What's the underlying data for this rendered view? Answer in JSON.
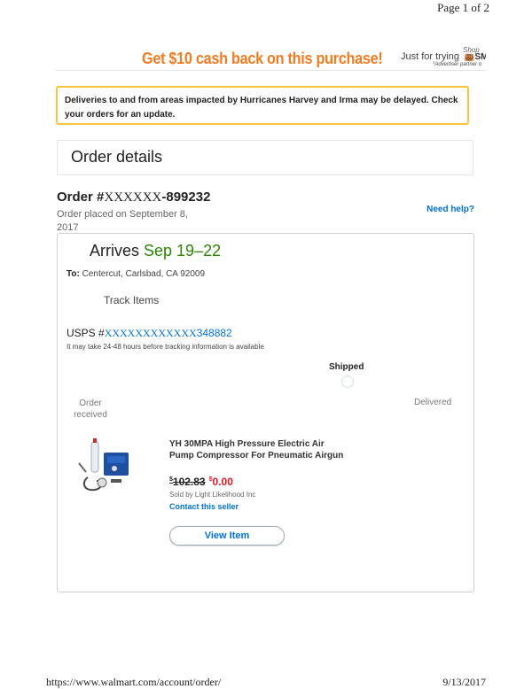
{
  "page": {
    "page_label": "Page 1 of 2"
  },
  "promo": {
    "text_pre": "Get ",
    "amount": "$10",
    "text_post": " cash back on this purchase!",
    "partner_text": "Just for trying",
    "partner_brand_small": "Shop",
    "partner_brand": "SMA",
    "partner_note": "*Advertiser partner o"
  },
  "alert": {
    "message": "Deliveries to and from areas impacted by Hurricanes Harvey and Irma may be delayed. Check your orders for an update."
  },
  "order_details_title": "Order details",
  "order": {
    "number_prefix": "Order #",
    "number_masked": "XXXXXX",
    "number_suffix": "-899232",
    "placed": "Order placed on September 8, 2017",
    "need_help": "Need help?"
  },
  "shipment": {
    "arrives_label": "Arrives ",
    "arrives_date": "Sep 19–22",
    "to_label": "To:",
    "to_address": "Centercut, Carlsbad, CA 92009",
    "track_items": "Track Items",
    "usps_label": "USPS #",
    "usps_masked": "XXXXXXXXXXXX",
    "usps_suffix": "348882",
    "tracking_note": "It may take 24-48 hours before tracking information is available",
    "status_current": "Shipped",
    "status_start": "Order received",
    "status_end": "Delivered"
  },
  "item": {
    "name": "YH 30MPA High Pressure Electric Air Pump Compressor For Pneumatic Airgun",
    "old_price_symbol": "$",
    "old_price": "102.83",
    "new_price_symbol": "$",
    "new_price": "0.00",
    "sold_by": "Sold by Light Likelihood Inc",
    "contact_seller": "Contact this seller",
    "view_item": "View Item",
    "image_icon": "air-compressor-product-image"
  },
  "footer": {
    "url": "https://www.walmart.com/account/order/",
    "date": "9/13/2017"
  },
  "colors": {
    "promo_orange": "#f47b20",
    "alert_border": "#f8c634",
    "link_blue": "#0071dc",
    "arrival_green": "#2a8703",
    "sale_red": "#de1c24"
  }
}
